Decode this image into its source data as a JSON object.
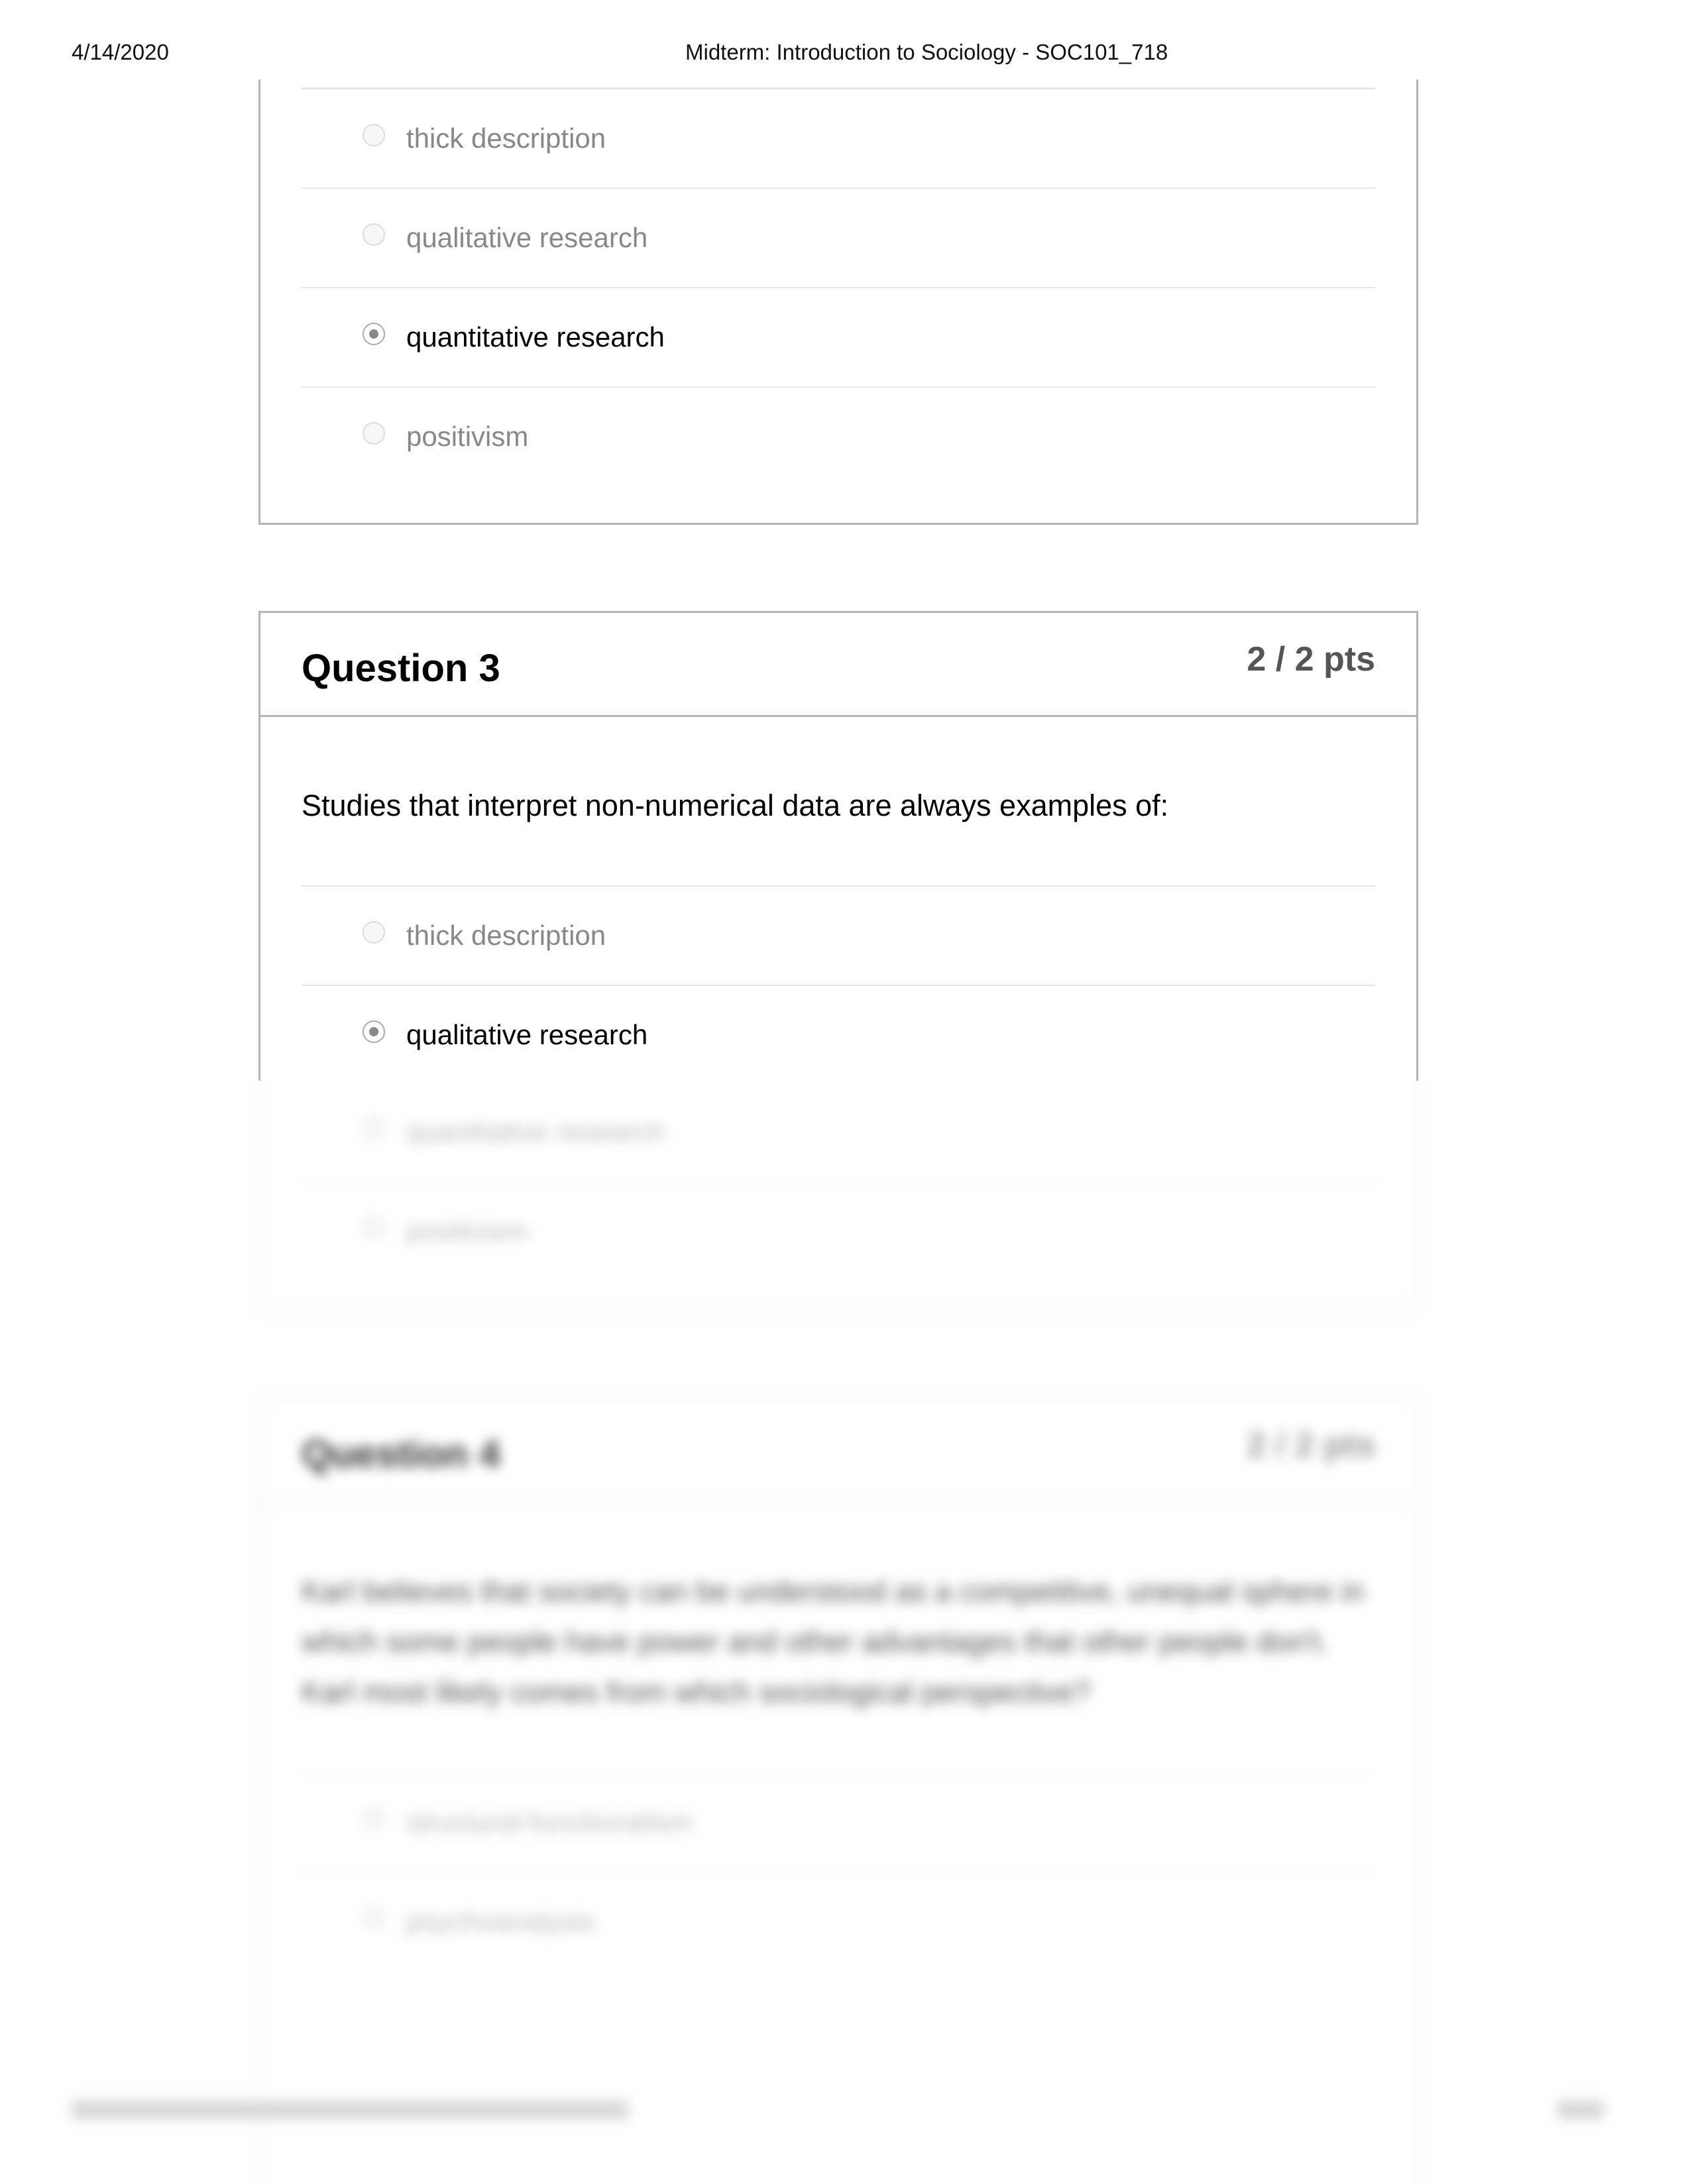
{
  "header": {
    "date": "4/14/2020",
    "title": "Midterm: Introduction to Sociology - SOC101_718"
  },
  "question2": {
    "options": [
      {
        "label": "thick description",
        "selected": false
      },
      {
        "label": "qualitative research",
        "selected": false
      },
      {
        "label": "quantitative research",
        "selected": true
      },
      {
        "label": "positivism",
        "selected": false
      }
    ]
  },
  "question3": {
    "title": "Question 3",
    "points": "2 / 2 pts",
    "text": "Studies that interpret non-numerical data are always examples of:",
    "options": [
      {
        "label": "thick description",
        "selected": false
      },
      {
        "label": "qualitative research",
        "selected": true
      },
      {
        "label": "quantitative research",
        "selected": false
      },
      {
        "label": "positivism",
        "selected": false
      }
    ]
  },
  "question4": {
    "title": "Question 4",
    "points": "2 / 2 pts",
    "text": "Karl believes that society can be understood as a competitive, unequal sphere in which some people have power and other advantages that other people don't. Karl most likely comes from which sociological perspective?",
    "options": [
      {
        "label": "structural-functionalism",
        "selected": false
      },
      {
        "label": "psychoanalysis",
        "selected": false
      }
    ]
  }
}
